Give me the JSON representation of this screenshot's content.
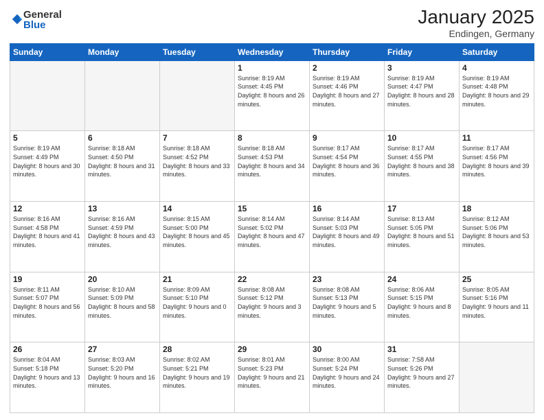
{
  "logo": {
    "general": "General",
    "blue": "Blue"
  },
  "header": {
    "month": "January 2025",
    "location": "Endingen, Germany"
  },
  "weekdays": [
    "Sunday",
    "Monday",
    "Tuesday",
    "Wednesday",
    "Thursday",
    "Friday",
    "Saturday"
  ],
  "weeks": [
    [
      {
        "day": "",
        "empty": true
      },
      {
        "day": "",
        "empty": true
      },
      {
        "day": "",
        "empty": true
      },
      {
        "day": "1",
        "sunrise": "Sunrise: 8:19 AM",
        "sunset": "Sunset: 4:45 PM",
        "daylight": "Daylight: 8 hours and 26 minutes."
      },
      {
        "day": "2",
        "sunrise": "Sunrise: 8:19 AM",
        "sunset": "Sunset: 4:46 PM",
        "daylight": "Daylight: 8 hours and 27 minutes."
      },
      {
        "day": "3",
        "sunrise": "Sunrise: 8:19 AM",
        "sunset": "Sunset: 4:47 PM",
        "daylight": "Daylight: 8 hours and 28 minutes."
      },
      {
        "day": "4",
        "sunrise": "Sunrise: 8:19 AM",
        "sunset": "Sunset: 4:48 PM",
        "daylight": "Daylight: 8 hours and 29 minutes."
      }
    ],
    [
      {
        "day": "5",
        "sunrise": "Sunrise: 8:19 AM",
        "sunset": "Sunset: 4:49 PM",
        "daylight": "Daylight: 8 hours and 30 minutes."
      },
      {
        "day": "6",
        "sunrise": "Sunrise: 8:18 AM",
        "sunset": "Sunset: 4:50 PM",
        "daylight": "Daylight: 8 hours and 31 minutes."
      },
      {
        "day": "7",
        "sunrise": "Sunrise: 8:18 AM",
        "sunset": "Sunset: 4:52 PM",
        "daylight": "Daylight: 8 hours and 33 minutes."
      },
      {
        "day": "8",
        "sunrise": "Sunrise: 8:18 AM",
        "sunset": "Sunset: 4:53 PM",
        "daylight": "Daylight: 8 hours and 34 minutes."
      },
      {
        "day": "9",
        "sunrise": "Sunrise: 8:17 AM",
        "sunset": "Sunset: 4:54 PM",
        "daylight": "Daylight: 8 hours and 36 minutes."
      },
      {
        "day": "10",
        "sunrise": "Sunrise: 8:17 AM",
        "sunset": "Sunset: 4:55 PM",
        "daylight": "Daylight: 8 hours and 38 minutes."
      },
      {
        "day": "11",
        "sunrise": "Sunrise: 8:17 AM",
        "sunset": "Sunset: 4:56 PM",
        "daylight": "Daylight: 8 hours and 39 minutes."
      }
    ],
    [
      {
        "day": "12",
        "sunrise": "Sunrise: 8:16 AM",
        "sunset": "Sunset: 4:58 PM",
        "daylight": "Daylight: 8 hours and 41 minutes."
      },
      {
        "day": "13",
        "sunrise": "Sunrise: 8:16 AM",
        "sunset": "Sunset: 4:59 PM",
        "daylight": "Daylight: 8 hours and 43 minutes."
      },
      {
        "day": "14",
        "sunrise": "Sunrise: 8:15 AM",
        "sunset": "Sunset: 5:00 PM",
        "daylight": "Daylight: 8 hours and 45 minutes."
      },
      {
        "day": "15",
        "sunrise": "Sunrise: 8:14 AM",
        "sunset": "Sunset: 5:02 PM",
        "daylight": "Daylight: 8 hours and 47 minutes."
      },
      {
        "day": "16",
        "sunrise": "Sunrise: 8:14 AM",
        "sunset": "Sunset: 5:03 PM",
        "daylight": "Daylight: 8 hours and 49 minutes."
      },
      {
        "day": "17",
        "sunrise": "Sunrise: 8:13 AM",
        "sunset": "Sunset: 5:05 PM",
        "daylight": "Daylight: 8 hours and 51 minutes."
      },
      {
        "day": "18",
        "sunrise": "Sunrise: 8:12 AM",
        "sunset": "Sunset: 5:06 PM",
        "daylight": "Daylight: 8 hours and 53 minutes."
      }
    ],
    [
      {
        "day": "19",
        "sunrise": "Sunrise: 8:11 AM",
        "sunset": "Sunset: 5:07 PM",
        "daylight": "Daylight: 8 hours and 56 minutes."
      },
      {
        "day": "20",
        "sunrise": "Sunrise: 8:10 AM",
        "sunset": "Sunset: 5:09 PM",
        "daylight": "Daylight: 8 hours and 58 minutes."
      },
      {
        "day": "21",
        "sunrise": "Sunrise: 8:09 AM",
        "sunset": "Sunset: 5:10 PM",
        "daylight": "Daylight: 9 hours and 0 minutes."
      },
      {
        "day": "22",
        "sunrise": "Sunrise: 8:08 AM",
        "sunset": "Sunset: 5:12 PM",
        "daylight": "Daylight: 9 hours and 3 minutes."
      },
      {
        "day": "23",
        "sunrise": "Sunrise: 8:08 AM",
        "sunset": "Sunset: 5:13 PM",
        "daylight": "Daylight: 9 hours and 5 minutes."
      },
      {
        "day": "24",
        "sunrise": "Sunrise: 8:06 AM",
        "sunset": "Sunset: 5:15 PM",
        "daylight": "Daylight: 9 hours and 8 minutes."
      },
      {
        "day": "25",
        "sunrise": "Sunrise: 8:05 AM",
        "sunset": "Sunset: 5:16 PM",
        "daylight": "Daylight: 9 hours and 11 minutes."
      }
    ],
    [
      {
        "day": "26",
        "sunrise": "Sunrise: 8:04 AM",
        "sunset": "Sunset: 5:18 PM",
        "daylight": "Daylight: 9 hours and 13 minutes."
      },
      {
        "day": "27",
        "sunrise": "Sunrise: 8:03 AM",
        "sunset": "Sunset: 5:20 PM",
        "daylight": "Daylight: 9 hours and 16 minutes."
      },
      {
        "day": "28",
        "sunrise": "Sunrise: 8:02 AM",
        "sunset": "Sunset: 5:21 PM",
        "daylight": "Daylight: 9 hours and 19 minutes."
      },
      {
        "day": "29",
        "sunrise": "Sunrise: 8:01 AM",
        "sunset": "Sunset: 5:23 PM",
        "daylight": "Daylight: 9 hours and 21 minutes."
      },
      {
        "day": "30",
        "sunrise": "Sunrise: 8:00 AM",
        "sunset": "Sunset: 5:24 PM",
        "daylight": "Daylight: 9 hours and 24 minutes."
      },
      {
        "day": "31",
        "sunrise": "Sunrise: 7:58 AM",
        "sunset": "Sunset: 5:26 PM",
        "daylight": "Daylight: 9 hours and 27 minutes."
      },
      {
        "day": "",
        "empty": true
      }
    ]
  ]
}
